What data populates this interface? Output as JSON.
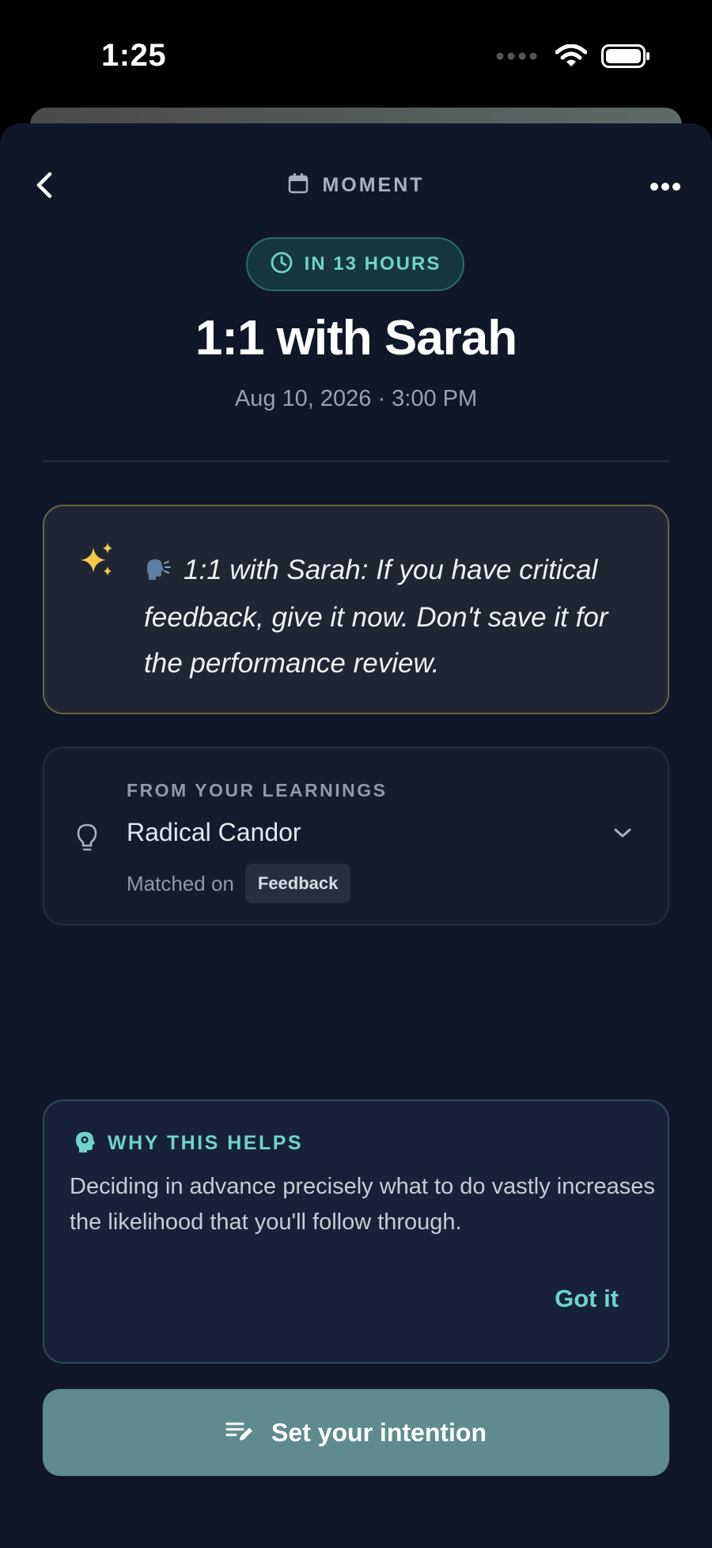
{
  "status_bar": {
    "time": "1:25"
  },
  "header": {
    "kind_label": "MOMENT"
  },
  "moment": {
    "countdown": "IN 13 HOURS",
    "title": "1:1 with Sarah",
    "datetime": "Aug 10, 2026 · 3:00 PM"
  },
  "quote": {
    "text": "1:1 with Sarah: If you have critical feedback, give it now. Don't save it for the performance review."
  },
  "learning": {
    "eyebrow": "FROM YOUR LEARNINGS",
    "title": "Radical Candor",
    "matched_label": "Matched on",
    "matched_tag": "Feedback"
  },
  "why": {
    "heading": "WHY THIS HELPS",
    "body": "Deciding in advance precisely what to do vastly increases the likelihood that you'll follow through.",
    "dismiss_label": "Got it"
  },
  "cta": {
    "label": "Set your intention"
  },
  "colors": {
    "background": "#0f1729",
    "accent_teal": "#6fd3c8",
    "cta": "#5f8b8e",
    "quote_border": "#6b6443",
    "sparkle": "#f2c94c"
  },
  "icons": {
    "back": "chevron-left-icon",
    "more": "more-horizontal-icon",
    "calendar": "calendar-icon",
    "clock": "clock-icon",
    "sparkle": "sparkles-icon",
    "speaking": "speaking-head-icon",
    "bulb": "lightbulb-icon",
    "expand": "chevron-down-icon",
    "why": "head-gear-icon",
    "cta": "edit-list-icon"
  }
}
